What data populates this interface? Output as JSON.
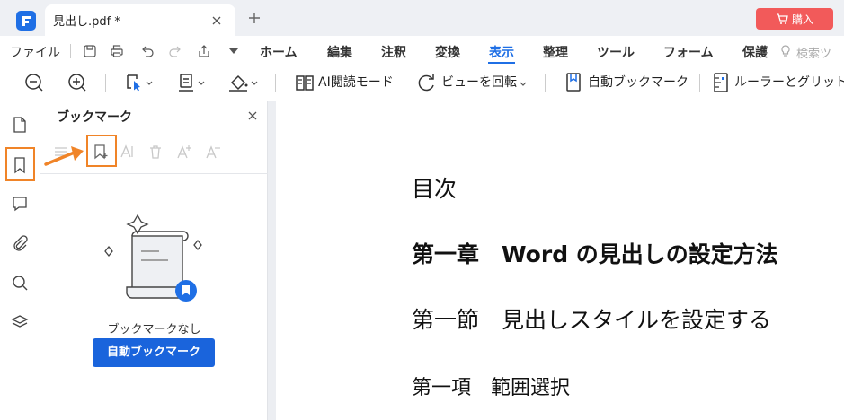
{
  "titlebar": {
    "tab_title": "見出し.pdf *",
    "buy_label": "購入"
  },
  "menubar": {
    "file": "ファイル",
    "items": [
      "ホーム",
      "編集",
      "注釈",
      "変換",
      "表示",
      "整理",
      "ツール",
      "フォーム",
      "保護"
    ],
    "active": "表示",
    "search_hint": "検索ツ"
  },
  "toolbar": {
    "ai_read_mode": "AI閲読モード",
    "rotate_view": "ビューを回転",
    "auto_bookmark": "自動ブックマーク",
    "ruler_grid": "ルーラーとグリット"
  },
  "panel": {
    "title": "ブックマーク",
    "empty_text": "ブックマークなし",
    "auto_bookmark_button": "自動ブックマーク"
  },
  "document": {
    "lines": [
      "目次",
      "第一章　Word の見出しの設定方法",
      "第一節　見出しスタイルを設定する",
      "第一項　範囲選択"
    ]
  },
  "colors": {
    "accent": "#1f6fe5",
    "buy_button": "#f25a5a",
    "highlight": "#f08428",
    "primary_button": "#1a64dc"
  }
}
